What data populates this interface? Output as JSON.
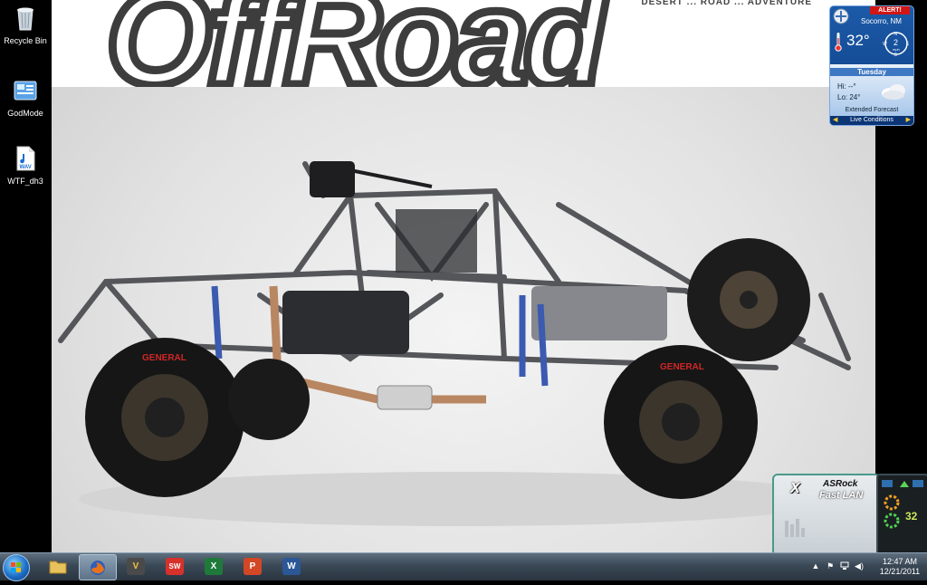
{
  "wallpaper": {
    "magazine_title": "OffRoad",
    "magazine_tagline": "DESERT ... ROAD ... ADVENTURE"
  },
  "desktop_icons": [
    {
      "label": "Recycle Bin",
      "icon": "recycle-bin-icon"
    },
    {
      "label": "GodMode",
      "icon": "control-panel-icon"
    },
    {
      "label": "WTF_dh3",
      "icon": "wav-file-icon",
      "badge": "WAV"
    }
  ],
  "weather": {
    "alert": "ALERT!",
    "city": "Socorro, NM",
    "temperature": "32°",
    "wind_speed": "2",
    "wind_unit": "mph",
    "compass": {
      "n": "N",
      "s": "S",
      "e": "E",
      "w": "W"
    },
    "day": "Tuesday",
    "hi": "Hi: --°",
    "lo": "Lo: 24°",
    "extended": "Extended Forecast",
    "footer": "Live Conditions"
  },
  "fastlan": {
    "brand": "ASRock",
    "name": "Fast LAN",
    "logo_letter": "X",
    "counter": "32"
  },
  "taskbar": {
    "apps": [
      {
        "name": "explorer",
        "icon": "folder-icon",
        "glyph": ""
      },
      {
        "name": "firefox",
        "icon": "firefox-icon",
        "glyph": ""
      },
      {
        "name": "vegas",
        "icon": "vegas-pro-icon",
        "glyph": "V"
      },
      {
        "name": "solidworks",
        "icon": "solidworks-icon",
        "glyph": "SW"
      },
      {
        "name": "excel",
        "icon": "excel-icon",
        "glyph": "X"
      },
      {
        "name": "powerpoint",
        "icon": "powerpoint-icon",
        "glyph": "P"
      },
      {
        "name": "word",
        "icon": "word-icon",
        "glyph": "W"
      }
    ],
    "clock_time": "12:47 AM",
    "clock_date": "12/21/2011"
  }
}
